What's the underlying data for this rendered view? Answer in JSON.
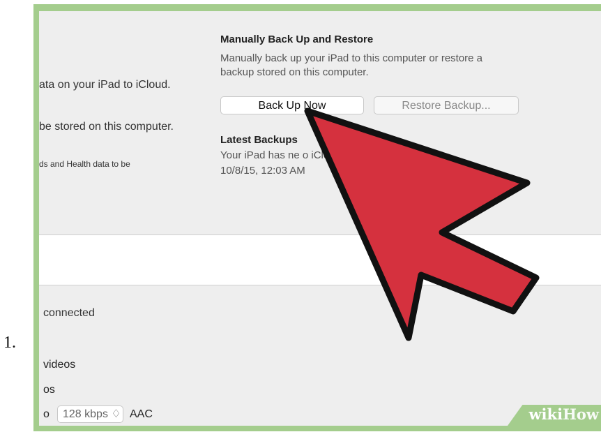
{
  "list_number": "1.",
  "left_panel": {
    "line1": "ata on your iPad to iCloud.",
    "line2": "be stored on this computer.",
    "line3": "ds and Health data to be"
  },
  "manual_backup": {
    "title": "Manually Back Up and Restore",
    "description_line1": "Manually back up your iPad to this computer or restore a",
    "description_line2": "backup stored on this computer.",
    "back_up_now_label": "Back Up Now",
    "restore_backup_label": "Restore Backup..."
  },
  "latest_backups": {
    "title": "Latest Backups",
    "line1": "Your iPad has ne                    o iCloud.",
    "line2": "10/8/15, 12:03 AM"
  },
  "options": {
    "connected": "connected",
    "videos": "videos",
    "os": "os",
    "o": "o",
    "bitrate_value": "128 kbps ♢",
    "format": "AAC"
  },
  "watermark": {
    "wiki": "wiki",
    "how": "How"
  },
  "colors": {
    "frame": "#a4cd8d",
    "arrow_fill": "#d5313e",
    "arrow_stroke": "#111111"
  },
  "icons": {
    "arrow": "red-pointer-arrow-icon"
  }
}
